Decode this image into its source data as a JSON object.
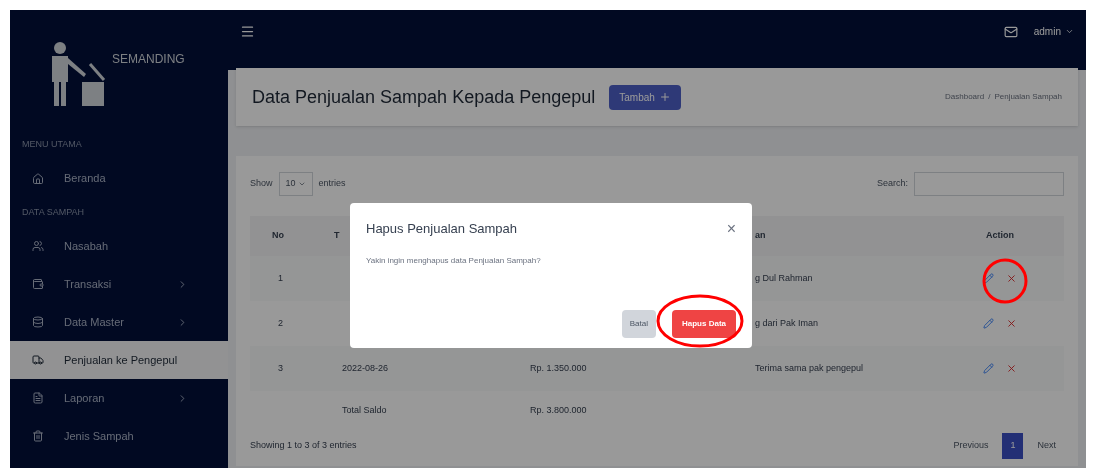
{
  "sidebar": {
    "brand": "SEMANDING",
    "items": [
      {
        "kind": "heading",
        "label": "MENU UTAMA"
      },
      {
        "kind": "item",
        "label": "Beranda",
        "selected": false,
        "expandable": false
      },
      {
        "kind": "heading",
        "label": "DATA SAMPAH"
      },
      {
        "kind": "item",
        "label": "Nasabah",
        "selected": false,
        "expandable": false
      },
      {
        "kind": "item",
        "label": "Transaksi",
        "selected": false,
        "expandable": true
      },
      {
        "kind": "item",
        "label": "Data Master",
        "selected": false,
        "expandable": true
      },
      {
        "kind": "item",
        "label": "Penjualan ke Pengepul",
        "selected": true,
        "expandable": false
      },
      {
        "kind": "item",
        "label": "Laporan",
        "selected": false,
        "expandable": true
      },
      {
        "kind": "item",
        "label": "Jenis Sampah",
        "selected": false,
        "expandable": false
      }
    ]
  },
  "navbar": {
    "user": "admin"
  },
  "page": {
    "title": "Data Penjualan Sampah Kepada Pengepul",
    "add_button": "Tambah",
    "breadcrumb": [
      "Dashboard",
      "Penjualan Sampah"
    ],
    "breadcrumb_separator": "/"
  },
  "table": {
    "show_label": "Show",
    "page_size": "10",
    "entries_label": "entries",
    "search_label": "Search:",
    "columns": [
      {
        "label": "No"
      },
      {
        "label": "T"
      },
      {},
      {
        "label": "an"
      },
      {
        "label": "Action"
      }
    ],
    "rows": [
      {
        "no": "1",
        "description": "g Dul Rahman"
      },
      {
        "no": "2",
        "description": "g dari Pak Iman"
      },
      {
        "no": "3",
        "date": "2022-08-26",
        "amount": "Rp. 1.350.000",
        "description": "Terima sama pak pengepul"
      }
    ],
    "total_label": "Total Saldo",
    "total": "Rp. 3.800.000",
    "info": "Showing 1 to 3 of 3 entries",
    "pagination": [
      {
        "label": "Previous",
        "selected": false
      },
      {
        "label": "1",
        "selected": true
      },
      {
        "label": "Next",
        "selected": false
      }
    ]
  },
  "modal": {
    "title": "Hapus Penjualan Sampah",
    "close": "×",
    "message": "Yakin ingin menghapus data Penjualan Sampah?",
    "cancel": "Batal",
    "confirm": "Hapus Data"
  }
}
